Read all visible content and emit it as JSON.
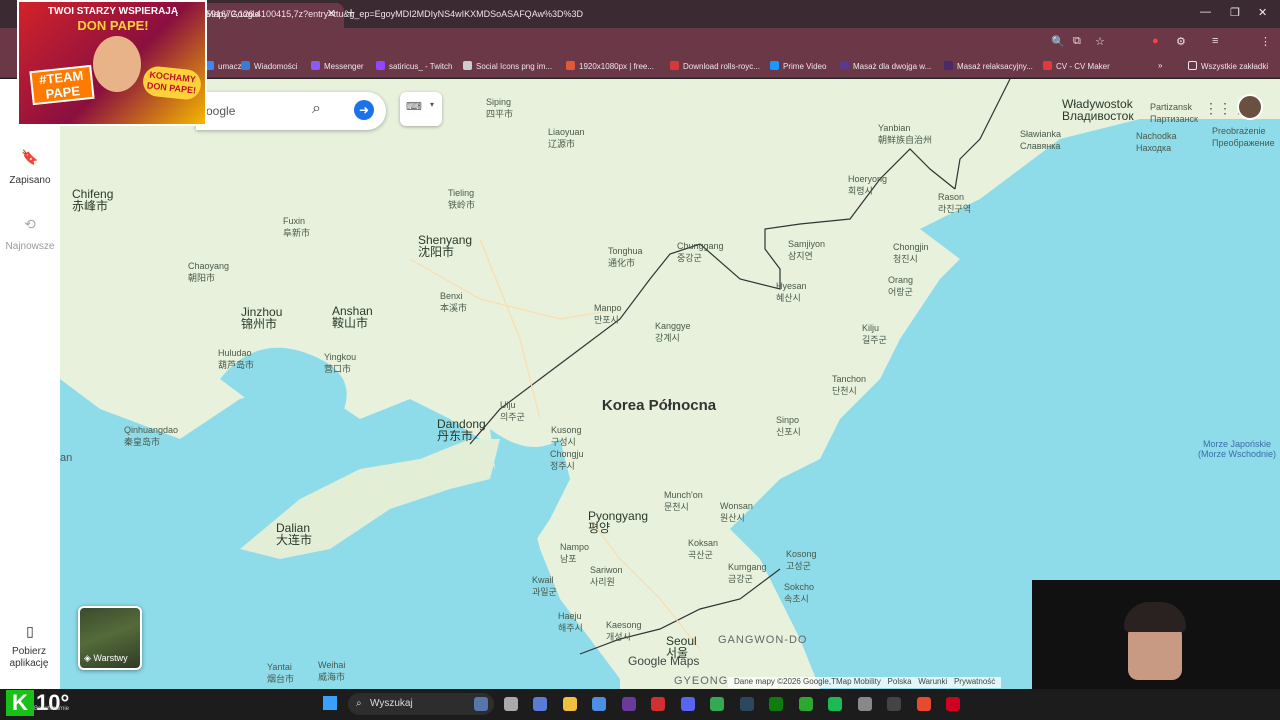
{
  "browser": {
    "tab_title": "Mapy Google",
    "url": "591672,126.4100415,7z?entry=ttu&g_ep=EgoyMDI2MDIyNS4wIKXMDSoASAFQAw%3D%3D",
    "bookmarks": [
      {
        "label": "umacz",
        "color": "#4285f4"
      },
      {
        "label": "Wiadomości",
        "color": "#3a7bd5"
      },
      {
        "label": "Messenger",
        "color": "#8a5cf6"
      },
      {
        "label": "satiricus_ - Twitch",
        "color": "#9146ff"
      },
      {
        "label": "Social Icons png im...",
        "color": "#cccccc"
      },
      {
        "label": "1920x1080px | free...",
        "color": "#e05a3a"
      },
      {
        "label": "Download rolls-royc...",
        "color": "#d43a3a"
      },
      {
        "label": "Prime Video",
        "color": "#1a98ff"
      },
      {
        "label": "Masaż dla dwojga w...",
        "color": "#5a3a8a"
      },
      {
        "label": "Masaż relaksacyjny...",
        "color": "#4a2a6a"
      },
      {
        "label": "CV - CV Maker",
        "color": "#e03a3a"
      }
    ],
    "all_bookmarks": "Wszystkie zakładki"
  },
  "promo": {
    "line1": "TWOI STARZY WSPIERAJĄ",
    "line2": "DON PAPE!",
    "tag": "#TEAM PAPE",
    "badge": "KOCHAMY DON PAPE!"
  },
  "search": {
    "placeholder": "oogle"
  },
  "sidebar": {
    "saved": "Zapisano",
    "recent": "Najnowsze",
    "get_app": "Pobierz aplikację"
  },
  "layers": {
    "label": "Warstwy"
  },
  "map": {
    "country": "Korea Północna",
    "places": [
      {
        "name": "Siping",
        "sub": "四平市"
      },
      {
        "name": "Liaoyuan",
        "sub": "辽源市"
      },
      {
        "name": "Yanbian",
        "sub": "朝鲜族自治州"
      },
      {
        "name": "Władywostok",
        "sub": "Владивосток"
      },
      {
        "name": "Partizansk",
        "sub": "Партизанск"
      },
      {
        "name": "Sławianka",
        "sub": "Славянка"
      },
      {
        "name": "Nachodka",
        "sub": "Находка"
      },
      {
        "name": "Preobrażenie",
        "sub": "Преображение"
      },
      {
        "name": "Chifeng",
        "sub": "赤峰市"
      },
      {
        "name": "Tieling",
        "sub": "铁岭市"
      },
      {
        "name": "Fuxin",
        "sub": "阜新市"
      },
      {
        "name": "Shenyang",
        "sub": "沈阳市"
      },
      {
        "name": "Hoeryong",
        "sub": "회령시"
      },
      {
        "name": "Rason",
        "sub": "라진구역"
      },
      {
        "name": "Tonghua",
        "sub": "通化市"
      },
      {
        "name": "Chunggang",
        "sub": "중강군"
      },
      {
        "name": "Samjiyon",
        "sub": "삼지연"
      },
      {
        "name": "Chongjin",
        "sub": "청진시"
      },
      {
        "name": "Chaoyang",
        "sub": "朝阳市"
      },
      {
        "name": "Hyesan",
        "sub": "혜산시"
      },
      {
        "name": "Orang",
        "sub": "어랑군"
      },
      {
        "name": "Benxi",
        "sub": "本溪市"
      },
      {
        "name": "Jinzhou",
        "sub": "锦州市"
      },
      {
        "name": "Anshan",
        "sub": "鞍山市"
      },
      {
        "name": "Manpo",
        "sub": "만포시"
      },
      {
        "name": "Kanggye",
        "sub": "강계시"
      },
      {
        "name": "Kilju",
        "sub": "길주군"
      },
      {
        "name": "Huludao",
        "sub": "葫芦岛市"
      },
      {
        "name": "Yingkou",
        "sub": "营口市"
      },
      {
        "name": "Tanchon",
        "sub": "단천시"
      },
      {
        "name": "Uiju",
        "sub": "의주군"
      },
      {
        "name": "Dandong",
        "sub": "丹东市"
      },
      {
        "name": "Kusong",
        "sub": "구성시"
      },
      {
        "name": "Sinpo",
        "sub": "신포시"
      },
      {
        "name": "Chongju",
        "sub": "정주시"
      },
      {
        "name": "Qinhuangdao",
        "sub": "秦皇岛市"
      },
      {
        "name": "Munch'on",
        "sub": "문천시"
      },
      {
        "name": "Wonsan",
        "sub": "원산시"
      },
      {
        "name": "Pyongyang",
        "sub": "평양"
      },
      {
        "name": "Dalian",
        "sub": "大连市"
      },
      {
        "name": "Nampo",
        "sub": "남포"
      },
      {
        "name": "Koksan",
        "sub": "곡산군"
      },
      {
        "name": "Kosong",
        "sub": "고성군"
      },
      {
        "name": "Sariwon",
        "sub": "사리원"
      },
      {
        "name": "Kumgang",
        "sub": "금강군"
      },
      {
        "name": "Kwail",
        "sub": "과일군"
      },
      {
        "name": "Sokcho",
        "sub": "속초시"
      },
      {
        "name": "Haeju",
        "sub": "해주시"
      },
      {
        "name": "Kaesong",
        "sub": "개성시"
      },
      {
        "name": "Seoul",
        "sub": "서울"
      },
      {
        "name": "Yantai",
        "sub": "烟台市"
      },
      {
        "name": "Weihai",
        "sub": "威海市"
      }
    ],
    "region": "GANGWON-DO",
    "region2": "GYEONG",
    "edge_label": "an",
    "sea_label": "Morze Japońskie",
    "sea_label_sub": "(Morze Wschodnie)",
    "logo": "Google Maps",
    "attribution": [
      "Dane mapy ©2026 Google,TMap Mobility",
      "Polska",
      "Warunki",
      "Prywatność"
    ]
  },
  "taskbar": {
    "search": "Wyszukaj",
    "weather": "10°",
    "weather_sub": "Bezchmurnie"
  }
}
